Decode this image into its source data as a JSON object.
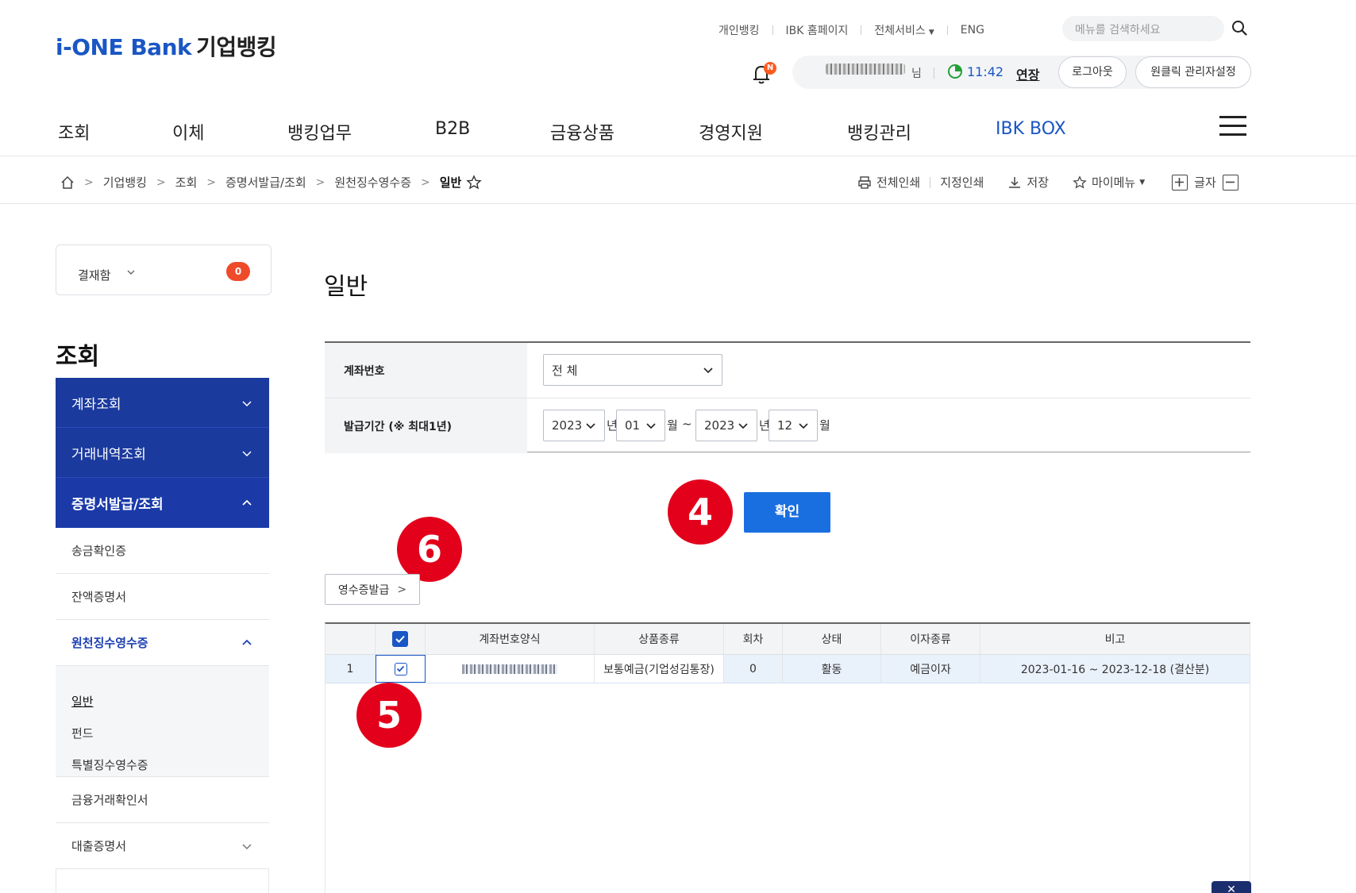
{
  "header": {
    "logo_brand": "i-ONE Bank",
    "logo_suffix": "기업뱅킹",
    "top_links": [
      "개인뱅킹",
      "IBK 홈페이지",
      "전체서비스",
      "ENG"
    ],
    "search_placeholder": "메뉴를 검색하세요",
    "notification_badge": "N",
    "user_suffix": "님",
    "session_time": "11:42",
    "extend_label": "연장",
    "logout_label": "로그아웃",
    "admin_settings_label": "원클릭 관리자설정"
  },
  "gnb": [
    "조회",
    "이체",
    "뱅킹업무",
    "B2B",
    "금융상품",
    "경영지원",
    "뱅킹관리",
    "IBK BOX"
  ],
  "breadcrumb": [
    "기업뱅킹",
    "조회",
    "증명서발급/조회",
    "원천징수영수증",
    "일반"
  ],
  "tools": {
    "print_all": "전체인쇄",
    "print_selected": "지정인쇄",
    "save": "저장",
    "my_menu": "마이메뉴",
    "font_size": "글자"
  },
  "sidebar": {
    "approval_label": "결재함",
    "approval_count": "0",
    "title": "조회",
    "items": [
      {
        "label": "계좌조회"
      },
      {
        "label": "거래내역조회"
      },
      {
        "label": "증명서발급/조회"
      }
    ],
    "sub_items": [
      "송금확인증",
      "잔액증명서",
      "원천징수영수증",
      "금융거래확인서",
      "대출증명서"
    ],
    "leaf_items": [
      "일반",
      "펀드",
      "특별징수영수증"
    ]
  },
  "main": {
    "page_title": "일반",
    "form": {
      "account_label": "계좌번호",
      "account_value": "전 체",
      "period_label": "발급기간 (※ 최대1년)",
      "from_year": "2023",
      "from_month": "01",
      "to_year": "2023",
      "to_month": "12",
      "unit_year": "년",
      "unit_month": "월",
      "tilde": "~"
    },
    "confirm_label": "확인",
    "receipt_button": "영수증발급",
    "steps": {
      "confirm": "4",
      "row_check": "5",
      "receipt": "6"
    },
    "table": {
      "headers": [
        "계좌번호양식",
        "상품종류",
        "회차",
        "상태",
        "이자종류",
        "비고"
      ],
      "rows": [
        {
          "no": "1",
          "product": "보통예금(기업성김통장)",
          "round": "0",
          "status": "활동",
          "interest": "예금이자",
          "note": "2023-01-16 ~ 2023-12-18 (결산분)"
        }
      ]
    }
  },
  "colors": {
    "brand_blue": "#1a56c4",
    "nav_blue": "#1b3a9e",
    "button_blue": "#1a6fe0",
    "step_red": "#e3001b"
  }
}
